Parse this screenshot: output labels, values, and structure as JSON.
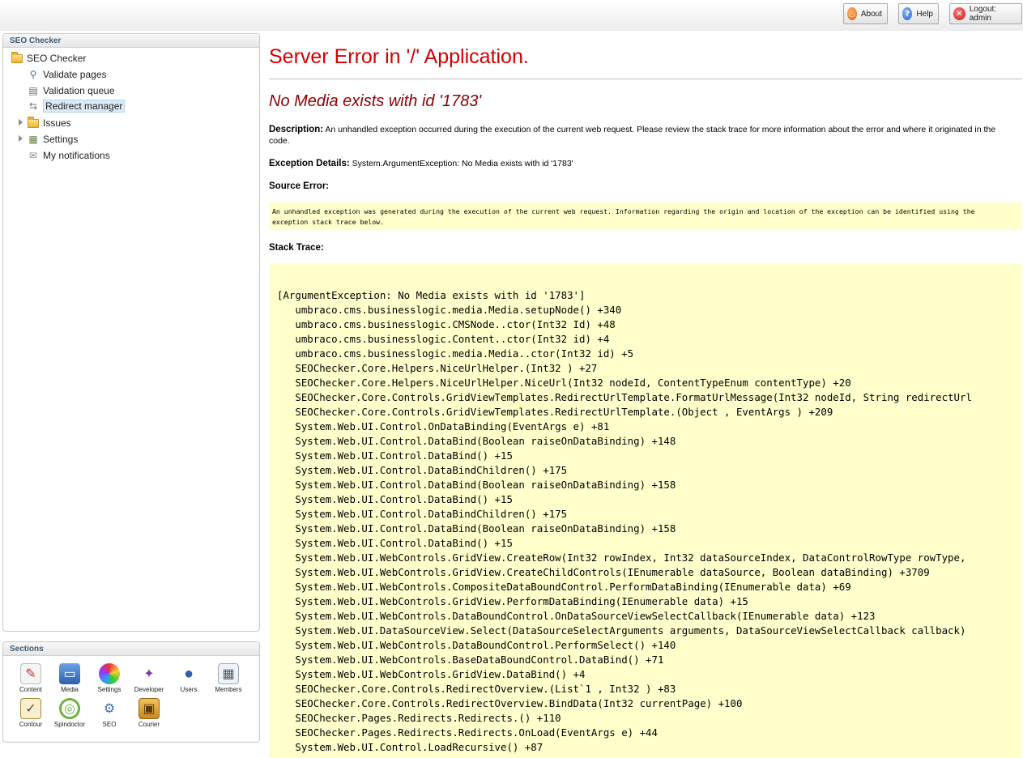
{
  "topbar": {
    "about_label": "About",
    "help_label": "Help",
    "logout_label": "Logout: admin"
  },
  "tree_panel": {
    "title": "SEO Checker",
    "items": [
      {
        "label": "SEO Checker",
        "icon": "folder-icon"
      },
      {
        "label": "Validate pages",
        "icon": "magnifier-icon"
      },
      {
        "label": "Validation queue",
        "icon": "queue-icon"
      },
      {
        "label": "Redirect manager",
        "icon": "redirect-icon"
      },
      {
        "label": "Issues",
        "icon": "folder-icon"
      },
      {
        "label": "Settings",
        "icon": "settings-icon"
      },
      {
        "label": "My notifications",
        "icon": "envelope-icon"
      }
    ]
  },
  "sections_panel": {
    "title": "Sections",
    "items": [
      {
        "label": "Content",
        "icon": "content-icon"
      },
      {
        "label": "Media",
        "icon": "media-icon"
      },
      {
        "label": "Settings",
        "icon": "settings-icon"
      },
      {
        "label": "Developer",
        "icon": "developer-icon"
      },
      {
        "label": "Users",
        "icon": "users-icon"
      },
      {
        "label": "Members",
        "icon": "members-icon"
      },
      {
        "label": "Contour",
        "icon": "contour-icon"
      },
      {
        "label": "Spindoctor",
        "icon": "spindoctor-icon"
      },
      {
        "label": "SEO",
        "icon": "seo-icon"
      },
      {
        "label": "Courier",
        "icon": "courier-icon"
      }
    ]
  },
  "error": {
    "title": "Server Error in '/' Application.",
    "subtitle": "No Media exists with id '1783'",
    "description_label": "Description:",
    "description_text": " An unhandled exception occurred during the execution of the current web request. Please review the stack trace for more information about the error and where it originated in the code.",
    "exception_label": "Exception Details:",
    "exception_text": " System.ArgumentException: No Media exists with id '1783'",
    "source_error_label": "Source Error:",
    "source_error_text": "An unhandled exception was generated during the execution of the current web request. Information regarding the origin and location of the exception can be identified using the\nexception stack trace below.",
    "stack_trace_label": "Stack Trace:",
    "stack_trace": [
      "[ArgumentException: No Media exists with id '1783']",
      "   umbraco.cms.businesslogic.media.Media.setupNode() +340",
      "   umbraco.cms.businesslogic.CMSNode..ctor(Int32 Id) +48",
      "   umbraco.cms.businesslogic.Content..ctor(Int32 id) +4",
      "   umbraco.cms.businesslogic.media.Media..ctor(Int32 id) +5",
      "   SEOChecker.Core.Helpers.NiceUrlHelper.(Int32 ) +27",
      "   SEOChecker.Core.Helpers.NiceUrlHelper.NiceUrl(Int32 nodeId, ContentTypeEnum contentType) +20",
      "   SEOChecker.Core.Controls.GridViewTemplates.RedirectUrlTemplate.FormatUrlMessage(Int32 nodeId, String redirectUrl",
      "   SEOChecker.Core.Controls.GridViewTemplates.RedirectUrlTemplate.(Object , EventArgs ) +209",
      "   System.Web.UI.Control.OnDataBinding(EventArgs e) +81",
      "   System.Web.UI.Control.DataBind(Boolean raiseOnDataBinding) +148",
      "   System.Web.UI.Control.DataBind() +15",
      "   System.Web.UI.Control.DataBindChildren() +175",
      "   System.Web.UI.Control.DataBind(Boolean raiseOnDataBinding) +158",
      "   System.Web.UI.Control.DataBind() +15",
      "   System.Web.UI.Control.DataBindChildren() +175",
      "   System.Web.UI.Control.DataBind(Boolean raiseOnDataBinding) +158",
      "   System.Web.UI.Control.DataBind() +15",
      "   System.Web.UI.WebControls.GridView.CreateRow(Int32 rowIndex, Int32 dataSourceIndex, DataControlRowType rowType,",
      "   System.Web.UI.WebControls.GridView.CreateChildControls(IEnumerable dataSource, Boolean dataBinding) +3709",
      "   System.Web.UI.WebControls.CompositeDataBoundControl.PerformDataBinding(IEnumerable data) +69",
      "   System.Web.UI.WebControls.GridView.PerformDataBinding(IEnumerable data) +15",
      "   System.Web.UI.WebControls.DataBoundControl.OnDataSourceViewSelectCallback(IEnumerable data) +123",
      "   System.Web.UI.DataSourceView.Select(DataSourceSelectArguments arguments, DataSourceViewSelectCallback callback)",
      "   System.Web.UI.WebControls.DataBoundControl.PerformSelect() +140",
      "   System.Web.UI.WebControls.BaseDataBoundControl.DataBind() +71",
      "   System.Web.UI.WebControls.GridView.DataBind() +4",
      "   SEOChecker.Core.Controls.RedirectOverview.(List`1 , Int32 ) +83",
      "   SEOChecker.Core.Controls.RedirectOverview.BindData(Int32 currentPage) +100",
      "   SEOChecker.Pages.Redirects.Redirects.() +110",
      "   SEOChecker.Pages.Redirects.Redirects.OnLoad(EventArgs e) +44",
      "   System.Web.UI.Control.LoadRecursive() +87"
    ]
  }
}
